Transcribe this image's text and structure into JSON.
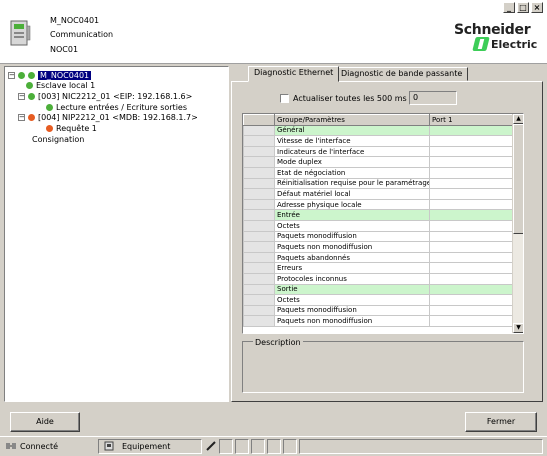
{
  "window": {
    "controls": [
      "_",
      "□",
      "×"
    ]
  },
  "header": {
    "line1": "M_NOC0401",
    "line2": "Communication",
    "line3": "NOC01",
    "logo_line1": "Schneider",
    "logo_line2": "Electric"
  },
  "tree": {
    "root": "M_NOC0401",
    "local_slave": "Esclave local 1",
    "node1": "[003] NIC2212_01 <EIP: 192.168.1.6>",
    "node1_child": "Lecture entrées / Ecriture sorties",
    "node2": "[004] NIP2212_01 <MDB: 192.168.1.7>",
    "node2_child": "Requête 1",
    "logging": "Consignation"
  },
  "tabs": {
    "ethernet": "Diagnostic Ethernet",
    "bandwidth": "Diagnostic de bande passante"
  },
  "refresh": {
    "label": "Actualiser toutes les 500 ms",
    "value": "0"
  },
  "grid": {
    "headers": [
      "Groupe/Paramètres",
      "Port 1"
    ],
    "rows": [
      {
        "param": "Général",
        "group": true
      },
      {
        "param": "Vitesse de l'interface"
      },
      {
        "param": "Indicateurs de l'interface"
      },
      {
        "param": "Mode duplex"
      },
      {
        "param": "Etat de négociation"
      },
      {
        "param": "Réinitialisation requise pour le paramétrage manuel"
      },
      {
        "param": "Défaut matériel local"
      },
      {
        "param": "Adresse physique locale"
      },
      {
        "param": "Entrée",
        "group": true
      },
      {
        "param": "Octets"
      },
      {
        "param": "Paquets monodiffusion"
      },
      {
        "param": "Paquets non monodiffusion"
      },
      {
        "param": "Paquets abandonnés"
      },
      {
        "param": "Erreurs"
      },
      {
        "param": "Protocoles inconnus"
      },
      {
        "param": "Sortie",
        "group": true
      },
      {
        "param": "Octets"
      },
      {
        "param": "Paquets monodiffusion"
      },
      {
        "param": "Paquets non monodiffusion"
      }
    ]
  },
  "description": {
    "label": "Description"
  },
  "buttons": {
    "help": "Aide",
    "close": "Fermer"
  },
  "statusbar": {
    "connected": "Connecté",
    "equipment": "Equipement"
  },
  "colors": {
    "group_row": "#ccf5cc",
    "selected": "#000080",
    "status_ok": "#4caf3a",
    "status_error": "#e65c22",
    "brand": "#3dcd58"
  }
}
